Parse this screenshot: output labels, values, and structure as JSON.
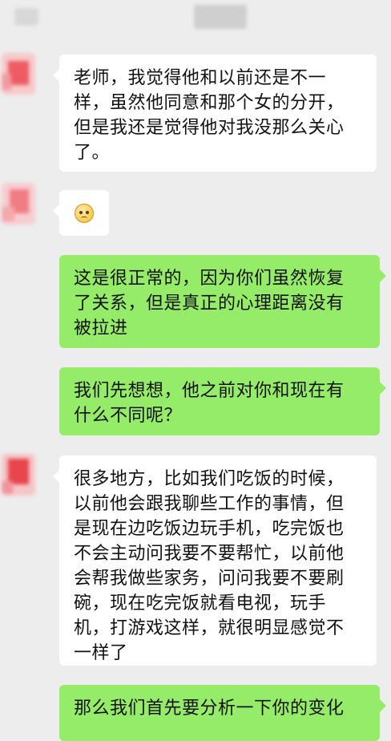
{
  "messages": [
    {
      "side": "left",
      "lines": [
        "老师，我觉得他和以前还是不一",
        "样，虽然他同意和那个女的分开，",
        "但是我还是觉得他对我没那么关心",
        "了。"
      ]
    },
    {
      "side": "left",
      "emoji": "pleading-face-icon"
    },
    {
      "side": "right",
      "lines": [
        "这是很正常的，因为你们虽然恢复",
        "了关系，但是真正的心理距离没有",
        "被拉进"
      ]
    },
    {
      "side": "right",
      "lines": [
        "我们先想想，他之前对你和现在有",
        "什么不同呢？"
      ]
    },
    {
      "side": "left",
      "lines": [
        "很多地方，比如我们吃饭的时候，",
        "以前他会跟我聊些工作的事情，但",
        "是现在边吃饭边玩手机，吃完饭也",
        "不会主动问我要不要帮忙，以前他",
        "会帮我做些家务，问问我要不要刷",
        "碗，现在吃完饭就看电视，玩手",
        "机，打游戏这样，就很明显感觉不",
        "一样了"
      ]
    },
    {
      "side": "right",
      "lines": [
        "那么我们首先要分析一下你的变化"
      ]
    }
  ],
  "colors": {
    "background": "#ededed",
    "sent_bubble": "#95ec69",
    "received_bubble": "#ffffff"
  }
}
